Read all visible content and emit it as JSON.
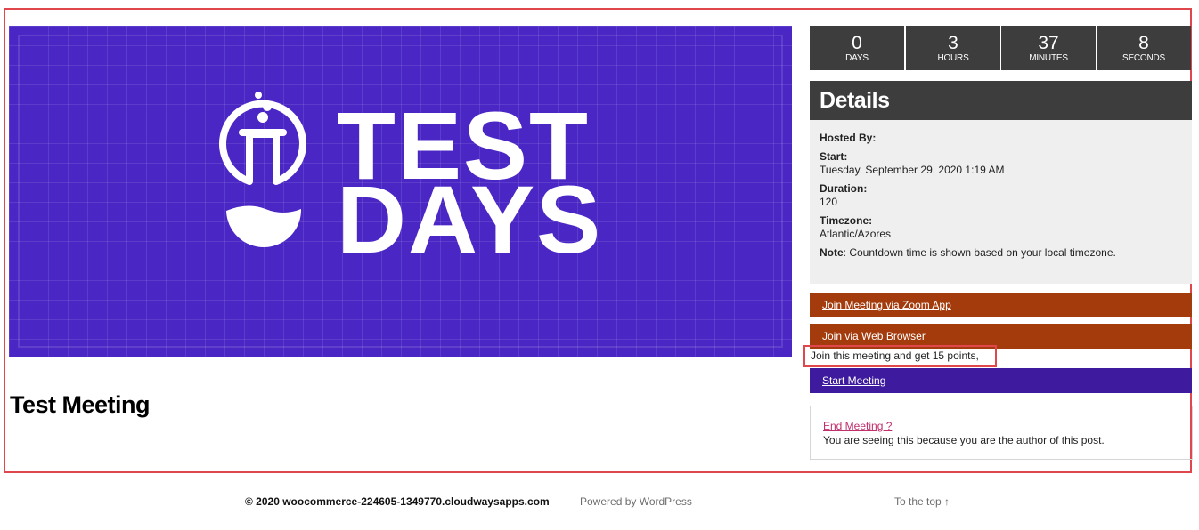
{
  "banner": {
    "logo_line1": "TEST",
    "logo_line2": "DAYS",
    "bg_color": "#4a26c4",
    "icon": "flask-icon"
  },
  "page": {
    "title": "Test Meeting"
  },
  "countdown": [
    {
      "value": "0",
      "label": "DAYS"
    },
    {
      "value": "3",
      "label": "HOURS"
    },
    {
      "value": "37",
      "label": "MINUTES"
    },
    {
      "value": "8",
      "label": "SECONDS"
    }
  ],
  "details": {
    "heading": "Details",
    "hosted_by_label": "Hosted By:",
    "start_label": "Start:",
    "start_value": "Tuesday, September 29, 2020 1:19 AM",
    "duration_label": "Duration:",
    "duration_value": "120",
    "timezone_label": "Timezone:",
    "timezone_value": "Atlantic/Azores",
    "note_label": "Note",
    "note_text": ": Countdown time is shown based on your local timezone."
  },
  "actions": {
    "join_zoom_app": "Join Meeting via Zoom App",
    "join_web_browser": "Join via Web Browser",
    "points_text": "Join this meeting and get 15 points,",
    "start_meeting": "Start Meeting"
  },
  "end_meeting": {
    "link": "End Meeting ?",
    "note": "You are seeing this because you are the author of this post."
  },
  "footer": {
    "copyright": "© 2020 woocommerce-224605-1349770.cloudwaysapps.com",
    "powered_by": "Powered by WordPress",
    "to_top": "To the top ↑"
  },
  "colors": {
    "highlight": "#e0474c",
    "dark_panel": "#3d3d3d",
    "zoom_button": "#a33b0c",
    "start_button": "#3e1a9e",
    "end_link": "#c0306d"
  }
}
